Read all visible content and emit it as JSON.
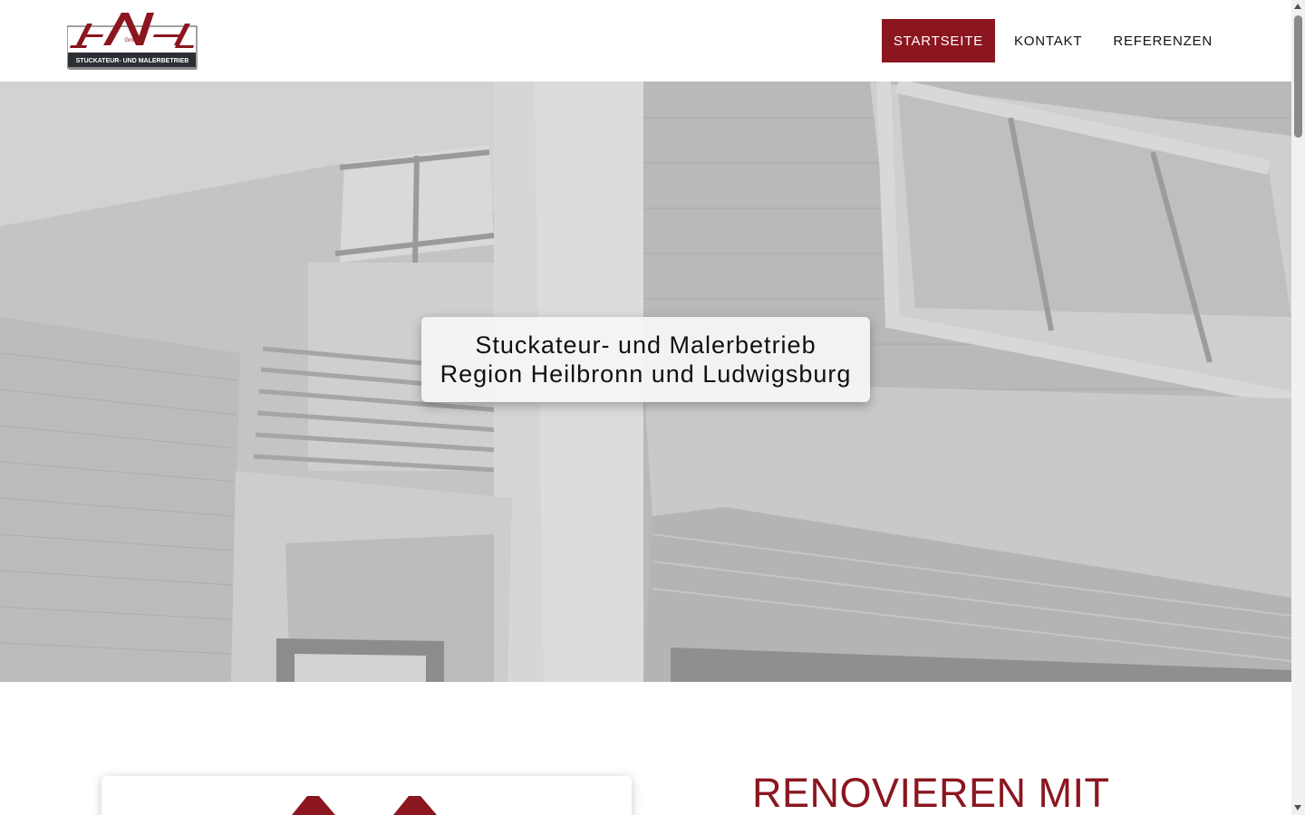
{
  "header": {
    "logo": {
      "letters": "HMH",
      "suffix": "GmbH",
      "tagline": "STUCKATEUR- UND MALERBETRIEB"
    },
    "nav": [
      {
        "label": "STARTSEITE",
        "active": true
      },
      {
        "label": "KONTAKT",
        "active": false
      },
      {
        "label": "REFERENZEN",
        "active": false
      }
    ]
  },
  "hero": {
    "line1": "Stuckateur- und Malerbetrieb",
    "line2": "Region Heilbronn und Ludwigsburg"
  },
  "section": {
    "heading": "RENOVIEREN MIT"
  },
  "colors": {
    "brand": "#8b1620",
    "logo_band": "#2b2f33",
    "nav_text": "#111111"
  }
}
